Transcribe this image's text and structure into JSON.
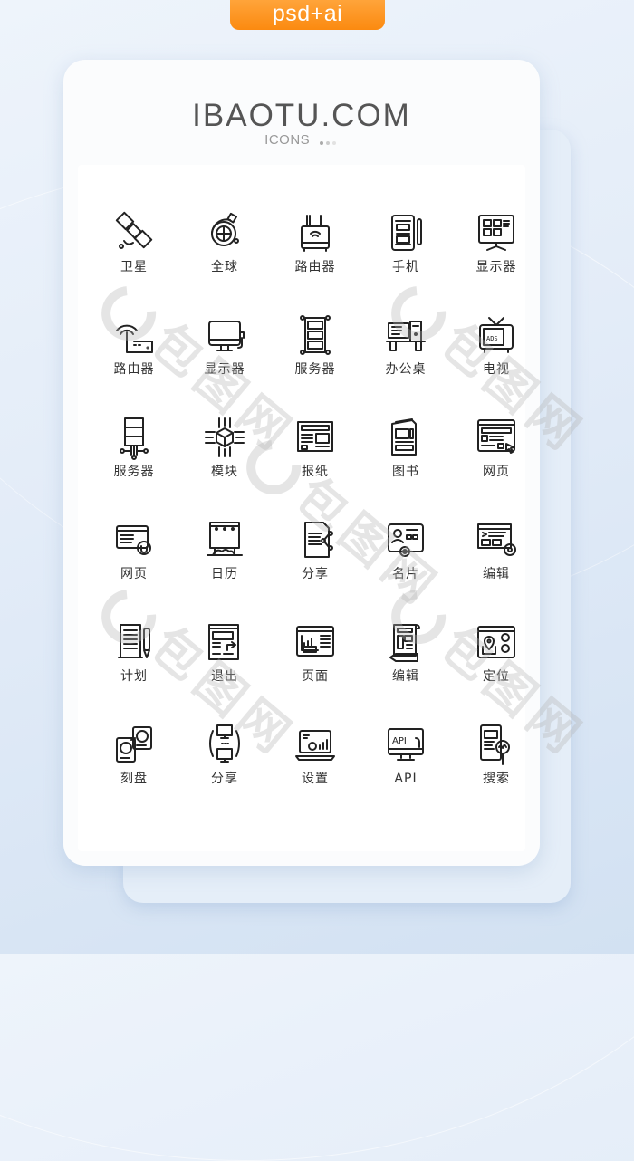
{
  "badge": {
    "label": "psd+ai",
    "color": "#fb8a10"
  },
  "header": {
    "brand": "IBAOTU.COM",
    "subtitle": "ICONS",
    "dot_colors": [
      "#aaaaaa",
      "#cccccc",
      "#e2e2e2"
    ]
  },
  "watermark": {
    "text": "包图网"
  },
  "icons": [
    {
      "label": "卫星",
      "icon": "satellite-icon"
    },
    {
      "label": "全球",
      "icon": "globe-icon"
    },
    {
      "label": "路由器",
      "icon": "router-icon"
    },
    {
      "label": "手机",
      "icon": "tablet-phone-icon"
    },
    {
      "label": "显示器",
      "icon": "dashboard-monitor-icon"
    },
    {
      "label": "路由器",
      "icon": "wifi-router-icon"
    },
    {
      "label": "显示器",
      "icon": "monitor-icon"
    },
    {
      "label": "服务器",
      "icon": "server-rack-icon"
    },
    {
      "label": "办公桌",
      "icon": "office-desk-icon"
    },
    {
      "label": "电视",
      "icon": "tv-ads-icon"
    },
    {
      "label": "服务器",
      "icon": "server-network-icon"
    },
    {
      "label": "模块",
      "icon": "module-chip-icon"
    },
    {
      "label": "报纸",
      "icon": "newspaper-icon"
    },
    {
      "label": "图书",
      "icon": "book-icon"
    },
    {
      "label": "网页",
      "icon": "webpage-cursor-icon"
    },
    {
      "label": "网页",
      "icon": "webpage-refresh-icon"
    },
    {
      "label": "日历",
      "icon": "billboard-calendar-icon"
    },
    {
      "label": "分享",
      "icon": "document-share-icon"
    },
    {
      "label": "名片",
      "icon": "business-card-icon"
    },
    {
      "label": "编辑",
      "icon": "code-editor-icon"
    },
    {
      "label": "计划",
      "icon": "plan-checklist-icon"
    },
    {
      "label": "退出",
      "icon": "document-exit-icon"
    },
    {
      "label": "页面",
      "icon": "page-chart-icon"
    },
    {
      "label": "编辑",
      "icon": "blueprint-pencil-icon"
    },
    {
      "label": "定位",
      "icon": "location-window-icon"
    },
    {
      "label": "刻盘",
      "icon": "disc-burn-icon"
    },
    {
      "label": "分享",
      "icon": "monitor-sync-icon"
    },
    {
      "label": "设置",
      "icon": "laptop-settings-icon"
    },
    {
      "label": "API",
      "icon": "api-monitor-icon"
    },
    {
      "label": "搜索",
      "icon": "search-document-icon"
    }
  ]
}
